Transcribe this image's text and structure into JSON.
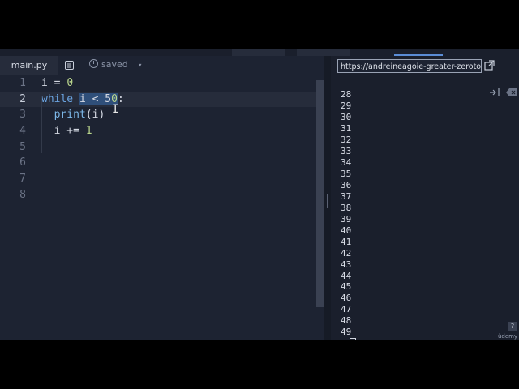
{
  "editor": {
    "tab_label": "main.py",
    "status": "saved",
    "format_icon": "format-icon",
    "lines": [
      {
        "n": "1",
        "segments": [
          {
            "t": "i = ",
            "c": ""
          },
          {
            "t": "0",
            "c": "num"
          }
        ]
      },
      {
        "n": "2",
        "segments": [
          {
            "t": "while",
            "c": "kw"
          },
          {
            "t": " ",
            "c": ""
          },
          {
            "t": "i < 5",
            "c": "sel"
          },
          {
            "t": "0",
            "c": "sel num"
          },
          {
            "t": ":",
            "c": ""
          }
        ]
      },
      {
        "n": "3",
        "segments": [
          {
            "t": "  ",
            "c": ""
          },
          {
            "t": "print",
            "c": "fn"
          },
          {
            "t": "(i)",
            "c": ""
          }
        ]
      },
      {
        "n": "4",
        "segments": [
          {
            "t": "  i += ",
            "c": ""
          },
          {
            "t": "1",
            "c": "num"
          }
        ]
      },
      {
        "n": "5",
        "segments": []
      },
      {
        "n": "6",
        "segments": []
      },
      {
        "n": "7",
        "segments": []
      },
      {
        "n": "8",
        "segments": []
      }
    ]
  },
  "console": {
    "url": "https://andreineagoie-greater-zerotomastery",
    "output": [
      "28",
      "29",
      "30",
      "31",
      "32",
      "33",
      "34",
      "35",
      "36",
      "37",
      "38",
      "39",
      "40",
      "41",
      "42",
      "43",
      "44",
      "45",
      "46",
      "47",
      "48",
      "49"
    ],
    "prompt": ">",
    "help": "?",
    "brand": "ûdemy"
  },
  "colors": {
    "background": "#1d2332",
    "console_bg": "#1a1f2c",
    "selection": "#2f4f7a",
    "keyword": "#6aa3e0",
    "number": "#b9d58c",
    "prompt": "#e0503b"
  }
}
